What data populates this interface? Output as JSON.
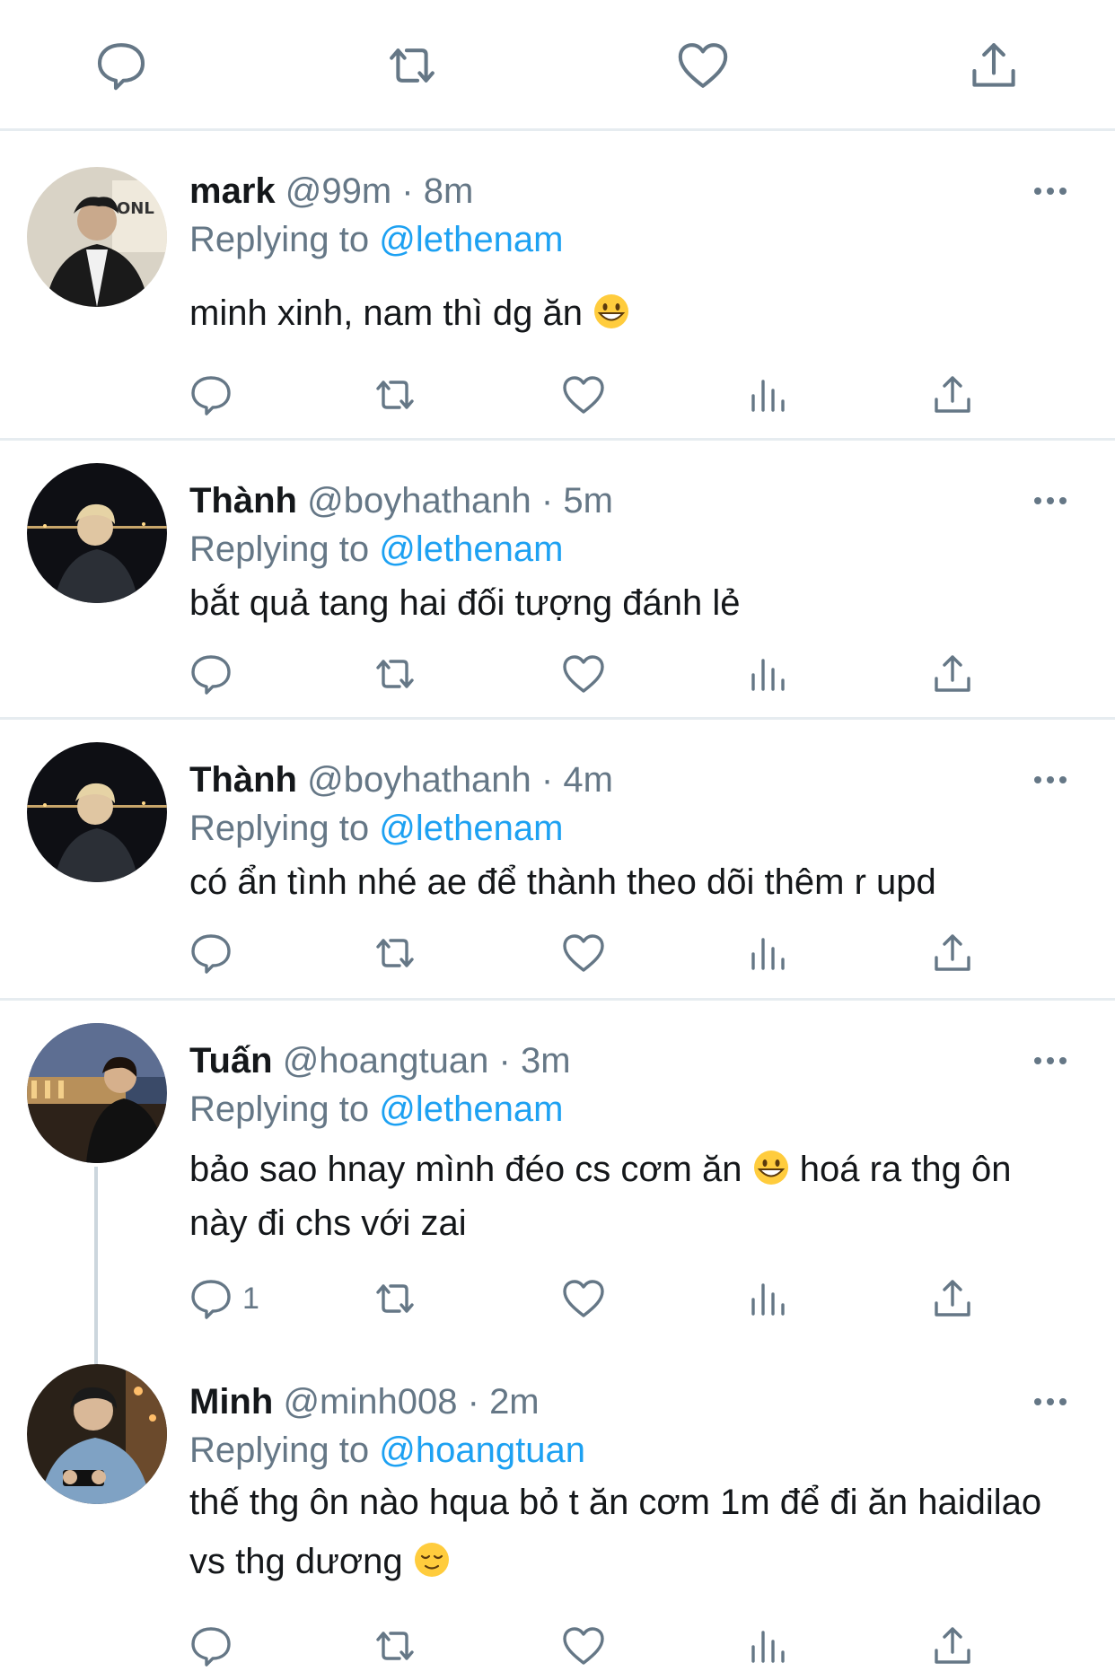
{
  "colors": {
    "accent": "#1da1f2",
    "muted": "#657786",
    "text": "#14171a",
    "divider": "#e6ecf0"
  },
  "top_actions": [
    {
      "icon": "reply-icon"
    },
    {
      "icon": "retweet-icon"
    },
    {
      "icon": "like-icon"
    },
    {
      "icon": "share-icon"
    }
  ],
  "tweets": [
    {
      "name": "mark",
      "handle": "@99m",
      "dot": "·",
      "time": "8m",
      "replying_prefix": "Replying to",
      "replying_to": "@lethenam",
      "text": "minh xinh, nam thì dg ăn",
      "emoji": "grinning-face",
      "reply_count": ""
    },
    {
      "name": "Thành",
      "handle": "@boyhathanh",
      "dot": "·",
      "time": "5m",
      "replying_prefix": "Replying to",
      "replying_to": "@lethenam",
      "text": "bắt quả tang hai đối tượng đánh lẻ",
      "reply_count": ""
    },
    {
      "name": "Thành",
      "handle": "@boyhathanh",
      "dot": "·",
      "time": "4m",
      "replying_prefix": "Replying to",
      "replying_to": "@lethenam",
      "text": "có ẩn tình nhé ae để thành theo dõi thêm r upd",
      "reply_count": ""
    },
    {
      "name": "Tuấn",
      "handle": "@hoangtuan",
      "dot": "·",
      "time": "3m",
      "replying_prefix": "Replying to",
      "replying_to": "@lethenam",
      "text_before": "bảo sao hnay mình đéo cs cơm ăn",
      "emoji": "grinning-face",
      "text_after": "hoá ra thg ôn này đi chs với zai",
      "reply_count": "1"
    },
    {
      "name": "Minh",
      "handle": "@minh008",
      "dot": "·",
      "time": "2m",
      "replying_prefix": "Replying to",
      "replying_to": "@hoangtuan",
      "text_before": "thế thg ôn nào hqua bỏ t ăn cơm 1m để đi ăn haidilao vs thg dương",
      "emoji": "relieved-face",
      "reply_count": ""
    }
  ]
}
